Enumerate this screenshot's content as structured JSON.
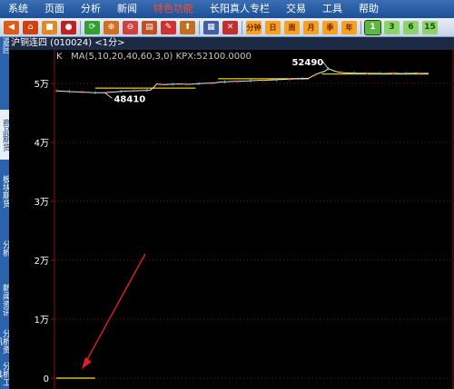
{
  "menubar": {
    "items": [
      "系统",
      "页面",
      "分析",
      "新闻",
      "特色功能",
      "长阳真人专栏",
      "交易",
      "工具",
      "帮助"
    ],
    "active_index": 4
  },
  "toolbar": {
    "icons": [
      "back-icon",
      "home-icon",
      "notebook-icon",
      "stop-icon",
      "refresh-icon",
      "zoom-in-icon",
      "zoom-out-icon",
      "stack-icon",
      "pen-icon",
      "rocket-icon",
      "grid-icon",
      "delete-chart-icon"
    ],
    "period_labels": [
      "分钟",
      "日",
      "周",
      "月",
      "季",
      "年"
    ],
    "number_labels": [
      "1",
      "3",
      "6",
      "15"
    ],
    "selected_number": "1"
  },
  "window": {
    "title": "沪铜连四 (010024)  <1分>"
  },
  "sidebar": {
    "tabs": [
      "返回",
      "商品期货",
      "板块期货",
      "分析",
      "新闻资讯",
      "分析资讯",
      "分析工具"
    ]
  },
  "indicator": {
    "label": "K",
    "ma_text": "MA(5,10,20,40,60,3,0) KPX:52100.0000"
  },
  "chart_data": {
    "type": "line",
    "title": "沪铜连四 (010024)  <1分>",
    "y_ticks": [
      "0",
      "1万",
      "2万",
      "3万",
      "4万",
      "5万"
    ],
    "ylim": [
      0,
      55000
    ],
    "annotations": [
      {
        "text": "48410",
        "x_index": 15,
        "y": 48410
      },
      {
        "text": "52490",
        "x_index": 84,
        "y": 52490
      }
    ],
    "levels": [
      {
        "x_start": 12,
        "x_end": 43,
        "y": 49200
      },
      {
        "x_start": 50,
        "x_end": 78,
        "y": 50800
      },
      {
        "x_start": 82,
        "x_end": 115,
        "y": 51600
      },
      {
        "x_start": 0,
        "x_end": 12,
        "y": 0
      }
    ],
    "series": [
      {
        "values": [
          48750,
          48700,
          48680,
          48650,
          48620,
          48600,
          48580,
          48560,
          48520,
          48500,
          48470,
          48450,
          48430,
          48420,
          48410,
          48430,
          48480,
          48520,
          48560,
          48600,
          48650,
          48680,
          48700,
          48720,
          48750,
          48760,
          48780,
          48800,
          48820,
          48850,
          49300,
          49900,
          49850,
          49800,
          49820,
          49840,
          49860,
          49880,
          49900,
          49880,
          49860,
          49850,
          49870,
          49900,
          49950,
          50000,
          50020,
          50030,
          50050,
          50100,
          50200,
          50250,
          50280,
          50300,
          50320,
          50340,
          50360,
          50380,
          50400,
          50420,
          50450,
          50480,
          50500,
          50520,
          50540,
          50560,
          50580,
          50600,
          50620,
          50650,
          50680,
          50700,
          50720,
          50750,
          50780,
          50800,
          50820,
          50850,
          50880,
          51200,
          51500,
          51700,
          51900,
          52100,
          52490,
          52300,
          52100,
          51950,
          51850,
          51800,
          51780,
          51760,
          51750,
          51740,
          51730,
          51720,
          51710,
          51700,
          51700,
          51700,
          51690,
          51680,
          51690,
          51700,
          51710,
          51700,
          51690,
          51680,
          51690,
          51700,
          51710,
          51720,
          51700,
          51690,
          51700,
          51710
        ]
      }
    ]
  },
  "colors": {
    "grid": "#8a1010",
    "axis_text": "#ffffff",
    "level_line": "#d4c000",
    "price_line": "#e8e8e8",
    "arrow": "#e02020"
  }
}
